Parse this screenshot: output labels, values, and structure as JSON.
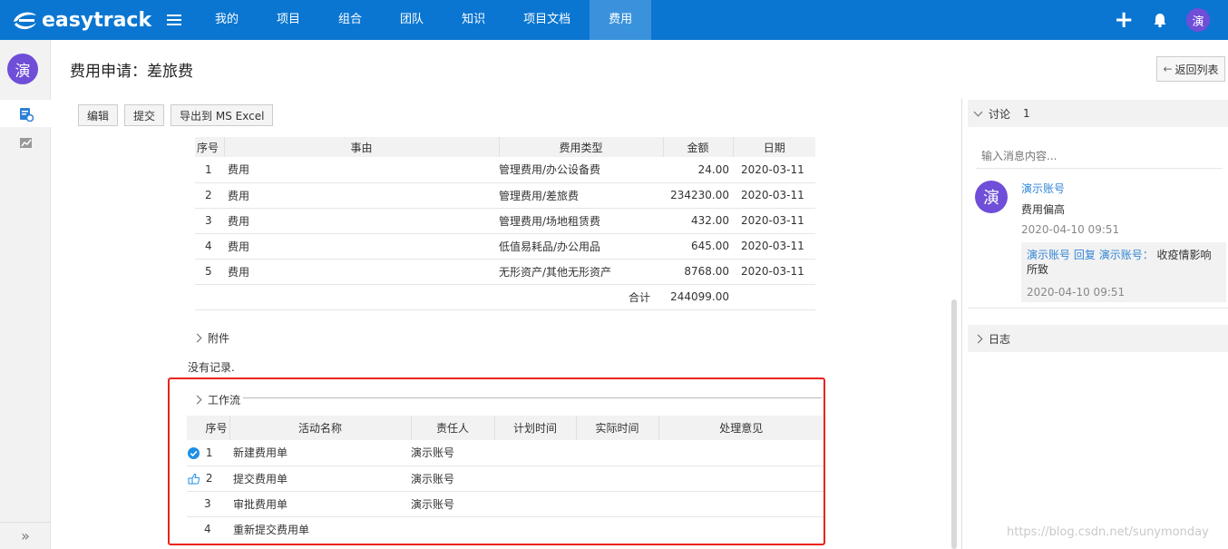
{
  "app": {
    "logo": "easytrack"
  },
  "nav": {
    "items": [
      {
        "label": "我的"
      },
      {
        "label": "项目"
      },
      {
        "label": "组合"
      },
      {
        "label": "团队"
      },
      {
        "label": "知识"
      },
      {
        "label": "项目文档"
      },
      {
        "label": "费用"
      }
    ],
    "active": "费用"
  },
  "user": {
    "avatar_char": "演"
  },
  "header": {
    "title": "费用申请：差旅费",
    "back_label": "返回列表"
  },
  "toolbar": {
    "edit": "编辑",
    "submit": "提交",
    "export": "导出到 MS Excel"
  },
  "expense_table": {
    "columns": [
      "序号",
      "事由",
      "费用类型",
      "金额",
      "日期"
    ],
    "rows": [
      {
        "no": "1",
        "reason": "费用",
        "type": "管理费用/办公设备费",
        "amount": "24.00",
        "date": "2020-03-11"
      },
      {
        "no": "2",
        "reason": "费用",
        "type": "管理费用/差旅费",
        "amount": "234230.00",
        "date": "2020-03-11"
      },
      {
        "no": "3",
        "reason": "费用",
        "type": "管理费用/场地租赁费",
        "amount": "432.00",
        "date": "2020-03-11"
      },
      {
        "no": "4",
        "reason": "费用",
        "type": "低值易耗品/办公用品",
        "amount": "645.00",
        "date": "2020-03-11"
      },
      {
        "no": "5",
        "reason": "费用",
        "type": "无形资产/其他无形资产",
        "amount": "8768.00",
        "date": "2020-03-11"
      }
    ],
    "total_label": "合计",
    "total": "244099.00"
  },
  "attachments": {
    "label": "附件",
    "empty": "没有记录."
  },
  "workflow": {
    "label": "工作流",
    "columns": [
      "序号",
      "活动名称",
      "责任人",
      "计划时间",
      "实际时间",
      "处理意见"
    ],
    "rows": [
      {
        "no": "1",
        "name": "新建费用单",
        "owner": "演示账号",
        "status": "done"
      },
      {
        "no": "2",
        "name": "提交费用单",
        "owner": "演示账号",
        "status": "current"
      },
      {
        "no": "3",
        "name": "审批费用单",
        "owner": "演示账号",
        "status": ""
      },
      {
        "no": "4",
        "name": "重新提交费用单",
        "owner": "",
        "status": ""
      }
    ]
  },
  "discussion": {
    "label": "讨论",
    "count": "1",
    "input_placeholder": "输入消息内容...",
    "comment": {
      "avatar": "演",
      "author": "演示账号",
      "text": "费用偏高",
      "time": "2020-04-10 09:51",
      "reply": {
        "from": "演示账号",
        "verb": "回复",
        "to": "演示账号：",
        "text": "收疫情影响所致",
        "time": "2020-04-10 09:51"
      }
    }
  },
  "log": {
    "label": "日志"
  },
  "watermark": "https://blog.csdn.net/sunymonday"
}
